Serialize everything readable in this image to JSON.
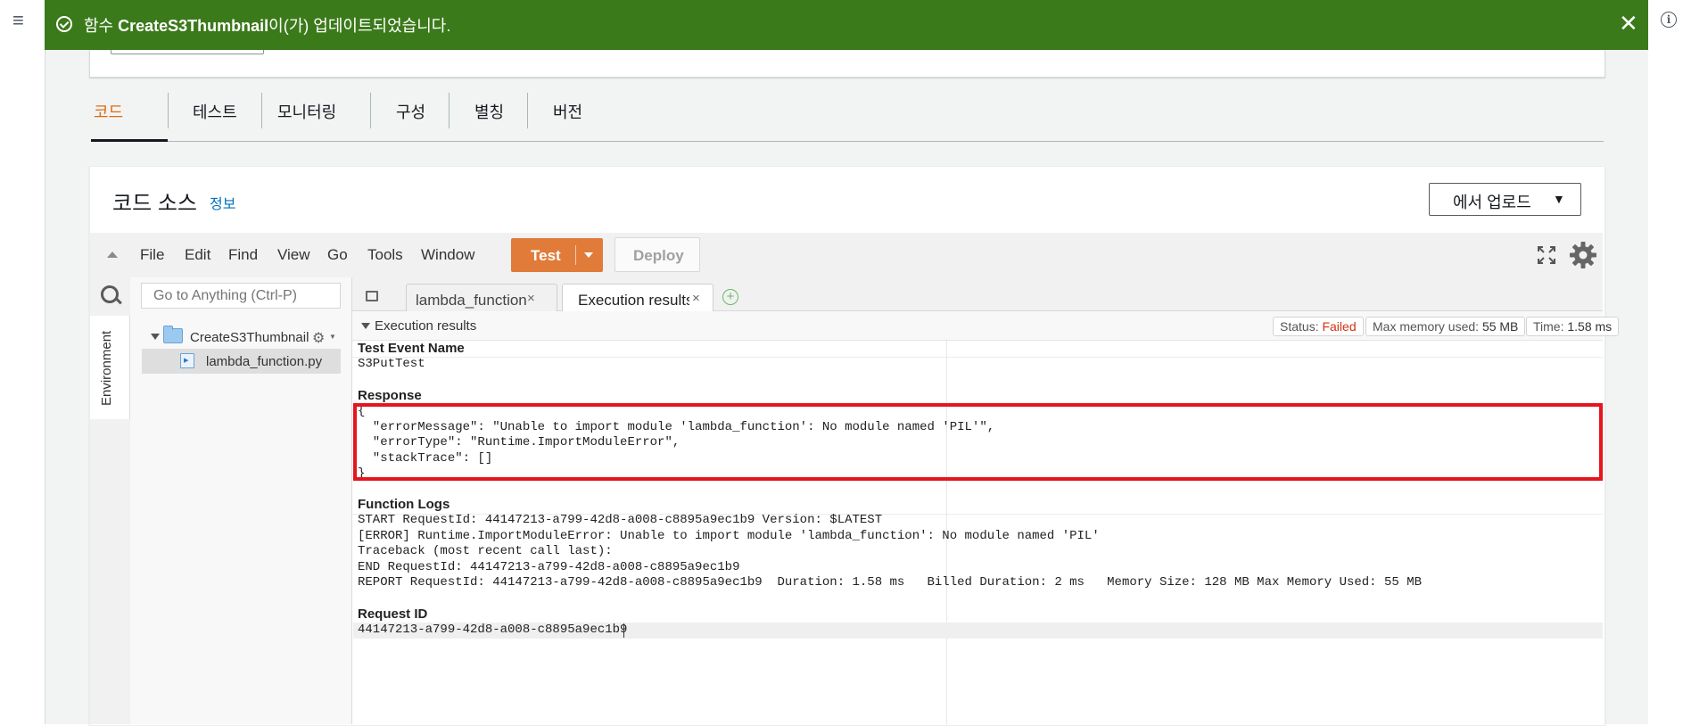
{
  "flash": {
    "prefix": "함수 ",
    "function_name": "CreateS3Thumbnail",
    "suffix": "이(가) 업데이트되었습니다.",
    "close": "✕"
  },
  "tabs": [
    "코드",
    "테스트",
    "모니터링",
    "구성",
    "별칭",
    "버전"
  ],
  "active_tab": "코드",
  "code_source": {
    "title": "코드 소스",
    "info_link": "정보",
    "upload_button": "에서 업로드",
    "upload_caret": "▼"
  },
  "ide": {
    "menus": [
      "File",
      "Edit",
      "Find",
      "View",
      "Go",
      "Tools",
      "Window"
    ],
    "test_button": "Test",
    "deploy_button": "Deploy",
    "search_placeholder": "Go to Anything (Ctrl-P)",
    "environment_label": "Environment",
    "folder_name": "CreateS3Thumbnail",
    "file_name": "lambda_function.py",
    "editor_tabs": [
      {
        "label": "lambda_function",
        "close": "×"
      },
      {
        "label": "Execution results",
        "close": "×"
      }
    ],
    "add_tab": "+"
  },
  "execution_results": {
    "title": "Execution results",
    "status_label": "Status: ",
    "status_value": "Failed",
    "memory_label": "Max memory used: ",
    "memory_value": "55 MB",
    "time_label": "Time: ",
    "time_value": "1.58 ms",
    "test_event_heading": "Test Event Name",
    "test_event_value": "S3PutTest",
    "response_heading": "Response",
    "response_body": "{\n  \"errorMessage\": \"Unable to import module 'lambda_function': No module named 'PIL'\",\n  \"errorType\": \"Runtime.ImportModuleError\",\n  \"stackTrace\": []\n}",
    "function_logs_heading": "Function Logs",
    "function_logs": "START RequestId: 44147213-a799-42d8-a008-c8895a9ec1b9 Version: $LATEST\n[ERROR] Runtime.ImportModuleError: Unable to import module 'lambda_function': No module named 'PIL'\nTraceback (most recent call last):\nEND RequestId: 44147213-a799-42d8-a008-c8895a9ec1b9\nREPORT RequestId: 44147213-a799-42d8-a008-c8895a9ec1b9  Duration: 1.58 ms   Billed Duration: 2 ms   Memory Size: 128 MB Max Memory Used: 55 MB",
    "request_id_heading": "Request ID",
    "request_id_value": "44147213-a799-42d8-a008-c8895a9ec1b9"
  },
  "colors": {
    "flash_success": "#3b7a1a",
    "test_button": "#e07b39",
    "active_tab": "#dd6b10",
    "status_failed": "#d13212",
    "highlight_box": "#e4151f",
    "link": "#0073bb"
  },
  "icons": [
    "hamburger-icon",
    "info-icon",
    "success-check-icon",
    "close-icon",
    "collapse-up-icon",
    "fullscreen-icon",
    "gear-icon",
    "search-icon",
    "folder-icon",
    "python-file-icon",
    "tab-menu-icon",
    "add-tab-icon"
  ]
}
